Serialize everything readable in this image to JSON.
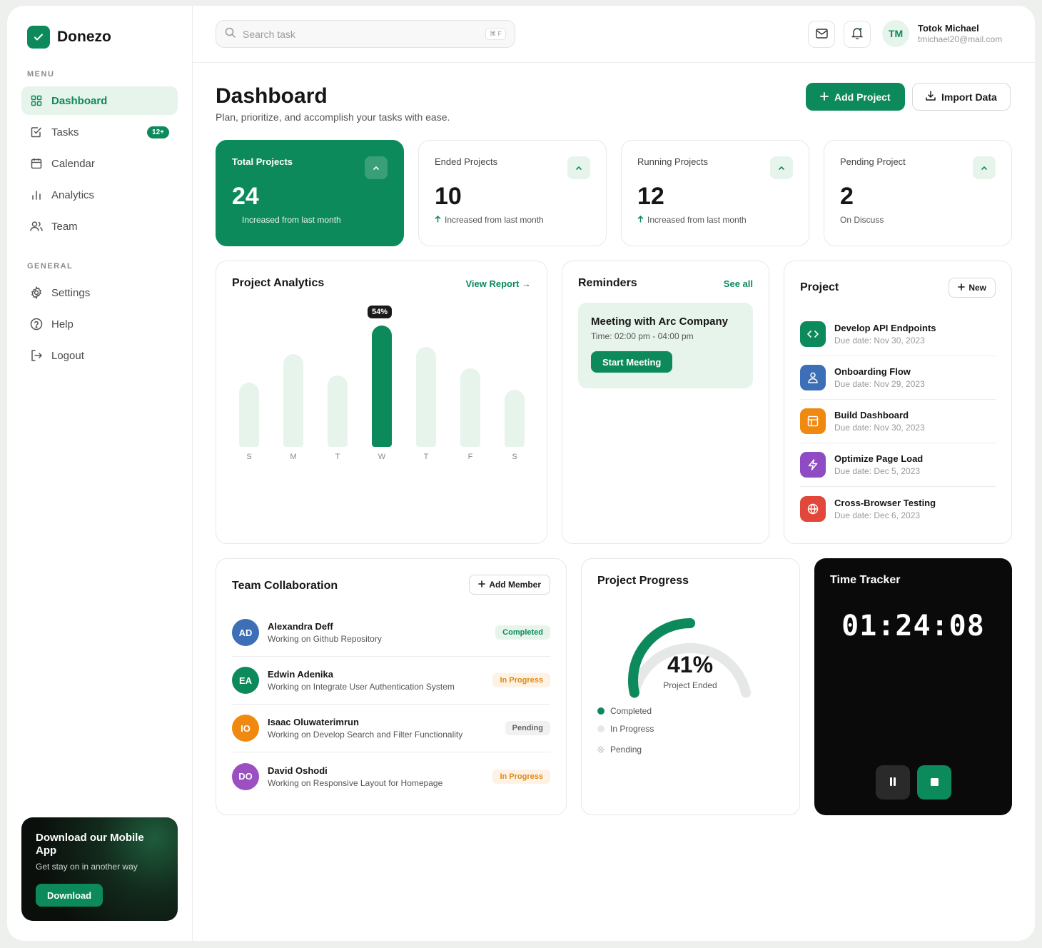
{
  "brand": {
    "name": "Donezo",
    "accent": "#0d8a5b"
  },
  "sidebar": {
    "menu_label": "MENU",
    "general_label": "GENERAL",
    "menu": [
      {
        "label": "Dashboard",
        "icon": "grid-icon",
        "active": true
      },
      {
        "label": "Tasks",
        "icon": "checkbox-icon",
        "badge": "12+"
      },
      {
        "label": "Calendar",
        "icon": "calendar-icon"
      },
      {
        "label": "Analytics",
        "icon": "bar-chart-icon"
      },
      {
        "label": "Team",
        "icon": "users-icon"
      }
    ],
    "general": [
      {
        "label": "Settings",
        "icon": "gear-icon"
      },
      {
        "label": "Help",
        "icon": "help-circle-icon"
      },
      {
        "label": "Logout",
        "icon": "logout-icon"
      }
    ],
    "promo": {
      "title": "Download our Mobile App",
      "subtitle": "Get stay on in another way",
      "button": "Download"
    }
  },
  "topbar": {
    "search": {
      "placeholder": "Search task",
      "shortcut": "⌘ F"
    },
    "user": {
      "initials": "TM",
      "name": "Totok Michael",
      "email": "tmichael20@mail.com"
    }
  },
  "header": {
    "title": "Dashboard",
    "subtitle": "Plan, prioritize, and accomplish your tasks with ease.",
    "add_project": "Add Project",
    "import_data": "Import Data"
  },
  "stats": [
    {
      "label": "Total Projects",
      "value": "24",
      "note": "Increased from last month"
    },
    {
      "label": "Ended Projects",
      "value": "10",
      "note": "Increased from last month"
    },
    {
      "label": "Running Projects",
      "value": "12",
      "note": "Increased from last month"
    },
    {
      "label": "Pending Project",
      "value": "2",
      "note": "On Discuss"
    }
  ],
  "analytics": {
    "title": "Project Analytics",
    "link": "View Report →",
    "highlight_label": "54%"
  },
  "chart_data": {
    "type": "bar",
    "categories": [
      "S",
      "M",
      "T",
      "W",
      "T",
      "F",
      "S"
    ],
    "values": [
      45,
      65,
      50,
      85,
      70,
      55,
      40
    ],
    "highlight_index": 3,
    "ylim": [
      0,
      100
    ],
    "grid": false
  },
  "reminders": {
    "title": "Reminders",
    "link": "See all",
    "item": {
      "title": "Meeting with Arc Company",
      "time": "Time: 02:00 pm - 04:00 pm",
      "button": "Start Meeting"
    }
  },
  "projects": {
    "title": "Project",
    "new_label": "New",
    "items": [
      {
        "name": "Develop API Endpoints",
        "due": "Due date: Nov 30, 2023",
        "icon": "code-icon",
        "color": "#0d8a5b"
      },
      {
        "name": "Onboarding Flow",
        "due": "Due date: Nov 29, 2023",
        "icon": "user-icon",
        "color": "#3d6fb6"
      },
      {
        "name": "Build Dashboard",
        "due": "Due date: Nov 30, 2023",
        "icon": "layout-icon",
        "color": "#f0890f"
      },
      {
        "name": "Optimize Page Load",
        "due": "Due date: Dec 5, 2023",
        "icon": "lightning-icon",
        "color": "#8e4bc4"
      },
      {
        "name": "Cross-Browser Testing",
        "due": "Due date: Dec 6, 2023",
        "icon": "globe-icon",
        "color": "#e2473b"
      }
    ]
  },
  "team": {
    "title": "Team Collaboration",
    "add_member": "Add Member",
    "members": [
      {
        "initials": "AD",
        "name": "Alexandra Deff",
        "task": "Working on Github Repository",
        "status": "Completed",
        "status_kind": "completed",
        "color": "#3d6fb6"
      },
      {
        "initials": "EA",
        "name": "Edwin Adenika",
        "task": "Working on Integrate User Authentication System",
        "status": "In Progress",
        "status_kind": "progress",
        "color": "#0d8a5b"
      },
      {
        "initials": "IO",
        "name": "Isaac Oluwaterimrun",
        "task": "Working on Develop Search and Filter Functionality",
        "status": "Pending",
        "status_kind": "pending",
        "color": "#f0890f"
      },
      {
        "initials": "DO",
        "name": "David Oshodi",
        "task": "Working on Responsive Layout for Homepage",
        "status": "In Progress",
        "status_kind": "progress",
        "color": "#9b4fc0"
      }
    ]
  },
  "progress": {
    "title": "Project Progress",
    "value": "41%",
    "percent": 41,
    "label": "Project Ended",
    "legend": [
      "Completed",
      "In Progress",
      "Pending"
    ]
  },
  "timer": {
    "title": "Time Tracker",
    "value": "01:24:08"
  }
}
